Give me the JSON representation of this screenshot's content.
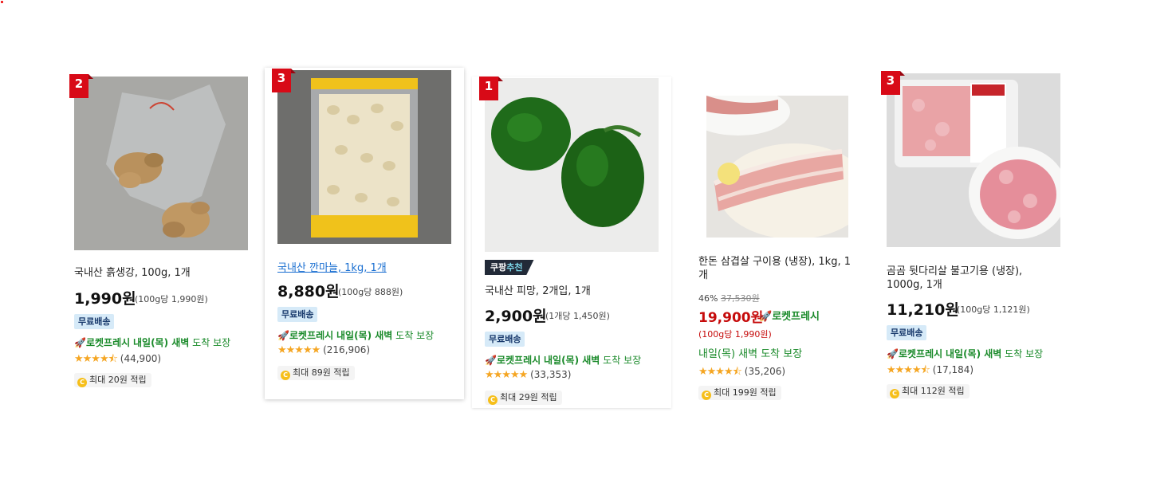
{
  "products": [
    {
      "rank": "2",
      "name": "국내산 흙생강, 100g, 1개",
      "price": "1,990원",
      "unit_price": "(100g당 1,990원)",
      "free_shipping": "무료배송",
      "rocket_brand": "로켓프레시",
      "delivery_day": "내일(목) 새벽",
      "delivery_suffix": "도착 보장",
      "rating": 4.5,
      "review_count": "(44,900)",
      "reward": "최대 20원 적립"
    },
    {
      "rank": "3",
      "name": "국내산 깐마늘, 1kg, 1개",
      "price": "8,880원",
      "unit_price": "(100g당 888원)",
      "free_shipping": "무료배송",
      "rocket_brand": "로켓프레시",
      "delivery_day": "내일(목) 새벽",
      "delivery_suffix": "도착 보장",
      "rating": 5,
      "review_count": "(216,906)",
      "reward": "최대 89원 적립"
    },
    {
      "rank": "1",
      "badge_main": "쿠팡",
      "badge_highlight": "추천",
      "name": "국내산 피망, 2개입, 1개",
      "price": "2,900원",
      "unit_price": "(1개당 1,450원)",
      "free_shipping": "무료배송",
      "rocket_brand": "로켓프레시",
      "delivery_day": "내일(목) 새벽",
      "delivery_suffix": "도착 보장",
      "rating": 5,
      "review_count": "(33,353)",
      "reward": "최대 29원 적립"
    },
    {
      "name": "한돈 삼겹살 구이용 (냉장), 1kg, 1개",
      "discount": "46%",
      "original_price": "37,530원",
      "price": "19,900원",
      "rocket_brand": "로켓프레시",
      "unit_price": "(100g당 1,990원)",
      "delivery_text": "내일(목) 새벽 도착 보장",
      "rating": 4.5,
      "review_count": "(35,206)",
      "reward": "최대 199원 적립"
    },
    {
      "rank": "3",
      "name": "곰곰 뒷다리살 불고기용 (냉장), 1000g, 1개",
      "price": "11,210원",
      "unit_price": "(100g당 1,121원)",
      "free_shipping": "무료배송",
      "rocket_brand": "로켓프레시",
      "delivery_day": "내일(목) 새벽",
      "delivery_suffix": "도착 보장",
      "rating": 4.5,
      "review_count": "(17,184)",
      "reward": "최대 112원 적립"
    }
  ],
  "colors": {
    "rank_red": "#d80a17",
    "price_red": "#c60b0b",
    "rocket_green": "#1a8a2a",
    "free_bg": "#d6eaf8",
    "star": "#f5a623"
  },
  "icons": [
    "rocket-icon",
    "star-icon",
    "coin-icon"
  ]
}
